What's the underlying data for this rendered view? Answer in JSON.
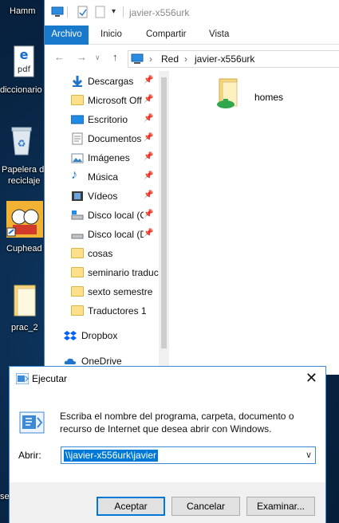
{
  "desktop": {
    "icons": [
      {
        "label": "Hamm"
      },
      {
        "label": "diccionario"
      },
      {
        "label_line1": "Papelera de",
        "label_line2": "reciclaje"
      },
      {
        "label": "Cuphead"
      },
      {
        "label": "prac_2"
      },
      {
        "label": "se"
      }
    ]
  },
  "explorer": {
    "title": "javier-x556urk",
    "ribbon_tabs": [
      "Archivo",
      "Inicio",
      "Compartir",
      "Vista"
    ],
    "breadcrumb": [
      "Red",
      "javier-x556urk"
    ],
    "nav_items": [
      {
        "label": "Descargas",
        "icon": "download-icon",
        "pinned": true
      },
      {
        "label": "Microsoft Off",
        "icon": "folder-icon",
        "pinned": true
      },
      {
        "label": "Escritorio",
        "icon": "desktop-icon",
        "pinned": true
      },
      {
        "label": "Documentos",
        "icon": "documents-icon",
        "pinned": true
      },
      {
        "label": "Imágenes",
        "icon": "pictures-icon",
        "pinned": true
      },
      {
        "label": "Música",
        "icon": "music-icon",
        "pinned": true
      },
      {
        "label": "Vídeos",
        "icon": "videos-icon",
        "pinned": true
      },
      {
        "label": "Disco local (C",
        "icon": "drive-icon",
        "pinned": true
      },
      {
        "label": "Disco local (D",
        "icon": "drive-icon",
        "pinned": true
      },
      {
        "label": "cosas",
        "icon": "folder-icon",
        "pinned": false
      },
      {
        "label": "seminario traduc",
        "icon": "folder-icon",
        "pinned": false
      },
      {
        "label": "sexto semestre",
        "icon": "folder-icon",
        "pinned": false
      },
      {
        "label": "Traductores 1",
        "icon": "folder-icon",
        "pinned": false
      },
      {
        "label": "Dropbox",
        "icon": "dropbox-icon",
        "pinned": false
      },
      {
        "label": "OneDrive",
        "icon": "onedrive-icon",
        "pinned": false
      }
    ],
    "content_items": [
      {
        "label": "homes",
        "icon": "shared-folder-icon"
      }
    ]
  },
  "run_dialog": {
    "title": "Ejecutar",
    "description": "Escriba el nombre del programa, carpeta, documento o recurso de Internet que desea abrir con Windows.",
    "open_label": "Abrir:",
    "open_value": "\\\\javier-x556urk\\javier",
    "ok_label": "Aceptar",
    "cancel_label": "Cancelar",
    "browse_label": "Examinar..."
  },
  "colors": {
    "accent": "#0078d7",
    "archivo_tab": "#1979ca",
    "folder": "#ffe08a"
  }
}
